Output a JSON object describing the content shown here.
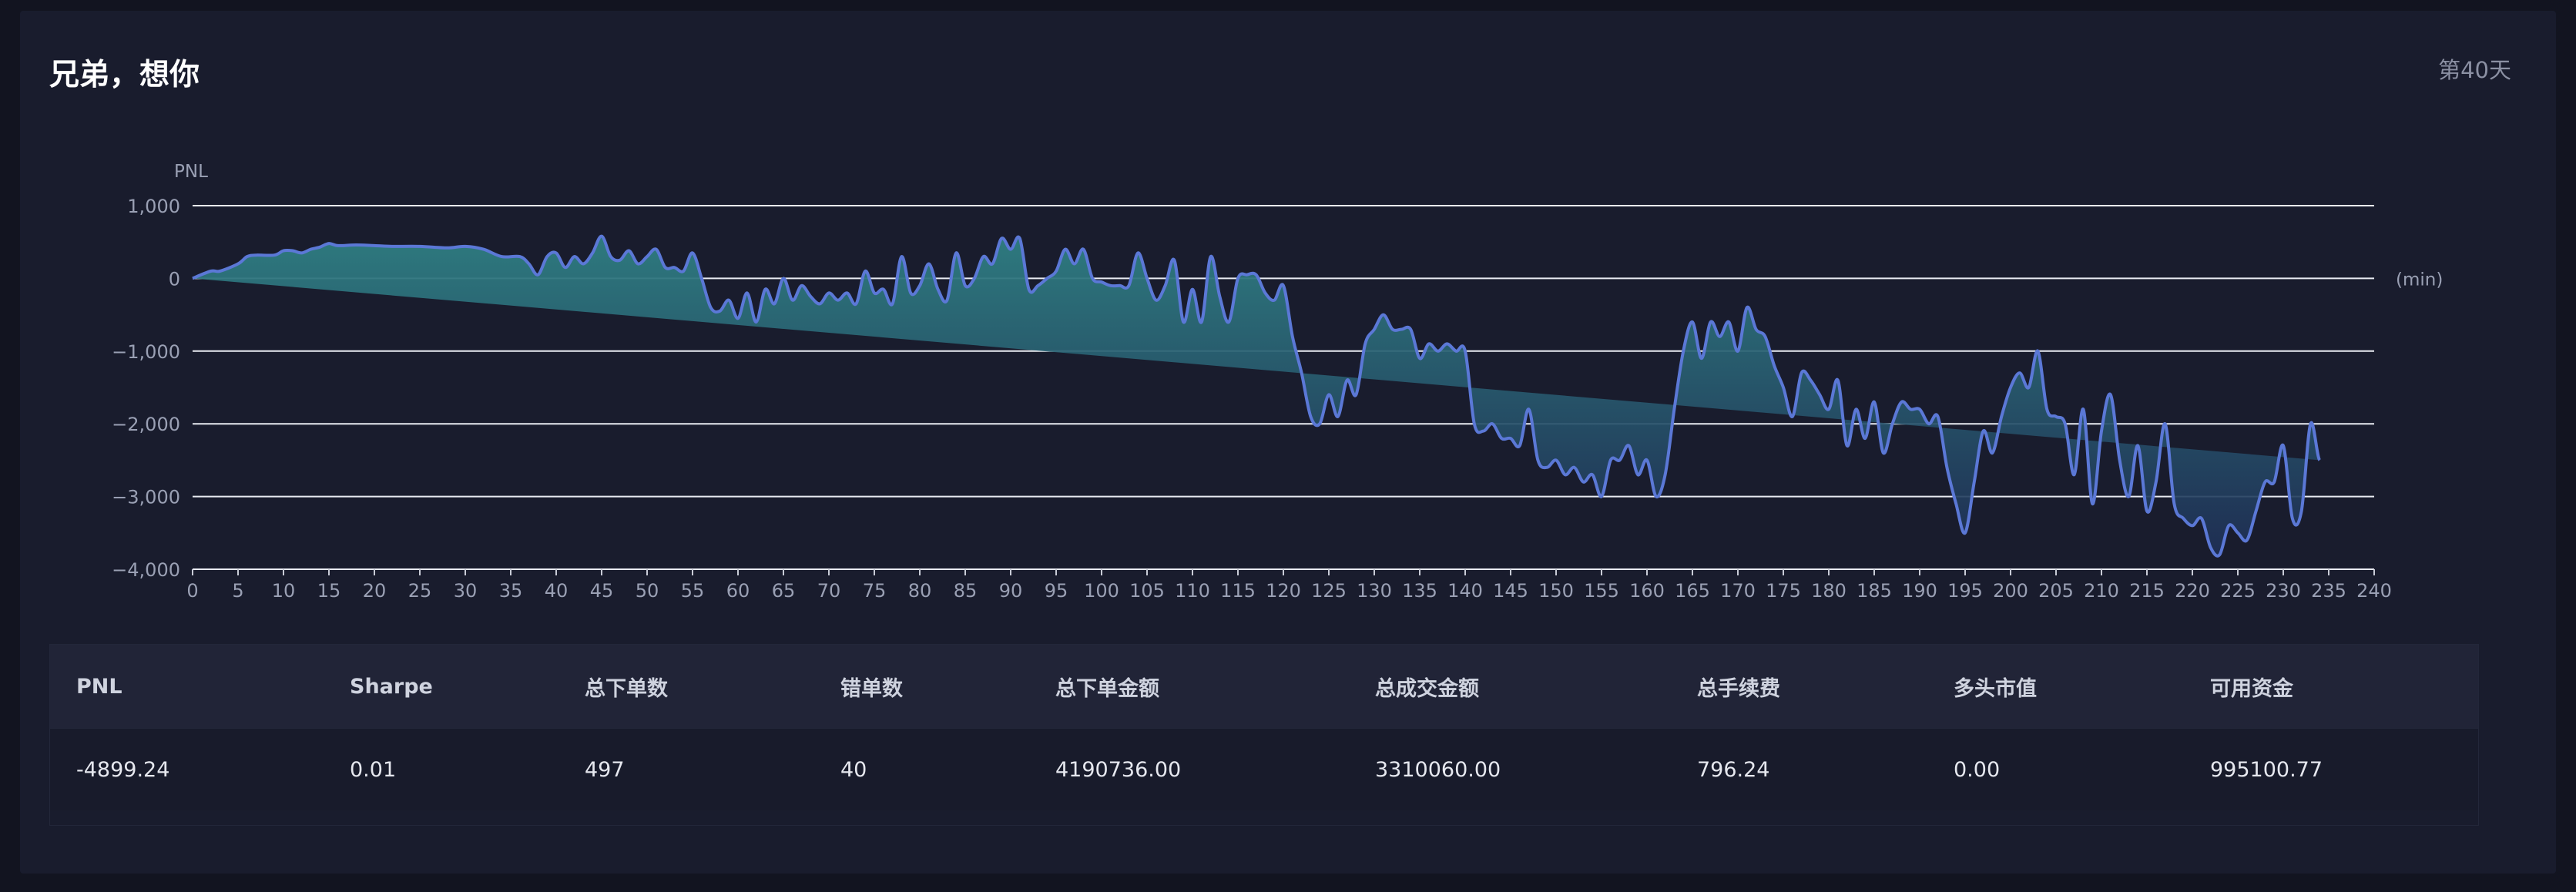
{
  "title": "兄弟，想你",
  "day_label": "第40天",
  "chart_data": {
    "type": "area",
    "ylabel": "PNL",
    "xlabel": "(min)",
    "ylim": [
      -4000,
      1000
    ],
    "yticks": [
      1000,
      0,
      -1000,
      -2000,
      -3000,
      -4000
    ],
    "ytick_labels": [
      "1,000",
      "0",
      "−1,000",
      "−2,000",
      "−3,000",
      "−4,000"
    ],
    "xlim": [
      0,
      240
    ],
    "xticks": [
      0,
      5,
      10,
      15,
      20,
      25,
      30,
      35,
      40,
      45,
      50,
      55,
      60,
      65,
      70,
      75,
      80,
      85,
      90,
      95,
      100,
      105,
      110,
      115,
      120,
      125,
      130,
      135,
      140,
      145,
      150,
      155,
      160,
      165,
      170,
      175,
      180,
      185,
      190,
      195,
      200,
      205,
      210,
      215,
      220,
      225,
      230,
      235,
      240
    ],
    "grid": true,
    "colors": {
      "line": "#5b78d6",
      "fill_top": "#2f7f83",
      "fill_bottom": "#1f2f56"
    },
    "x": [
      0,
      2,
      3,
      5,
      6,
      7,
      9,
      10,
      11,
      12,
      13,
      14,
      15,
      16,
      18,
      20,
      22,
      25,
      28,
      30,
      32,
      34,
      36,
      37,
      38,
      39,
      40,
      41,
      42,
      43,
      44,
      45,
      46,
      47,
      48,
      49,
      50,
      51,
      52,
      53,
      54,
      55,
      56,
      57,
      58,
      59,
      60,
      61,
      62,
      63,
      64,
      65,
      66,
      67,
      68,
      69,
      70,
      71,
      72,
      73,
      74,
      75,
      76,
      77,
      78,
      79,
      80,
      81,
      82,
      83,
      84,
      85,
      86,
      87,
      88,
      89,
      90,
      91,
      92,
      93,
      94,
      95,
      96,
      97,
      98,
      99,
      100,
      101,
      102,
      103,
      104,
      105,
      106,
      107,
      108,
      109,
      110,
      111,
      112,
      113,
      114,
      115,
      116,
      117,
      118,
      119,
      120,
      121,
      122,
      123,
      124,
      125,
      126,
      127,
      128,
      129,
      130,
      131,
      132,
      133,
      134,
      135,
      136,
      137,
      138,
      139,
      140,
      141,
      142,
      143,
      144,
      145,
      146,
      147,
      148,
      149,
      150,
      151,
      152,
      153,
      154,
      155,
      156,
      157,
      158,
      159,
      160,
      161,
      162,
      163,
      164,
      165,
      166,
      167,
      168,
      169,
      170,
      171,
      172,
      173,
      174,
      175,
      176,
      177,
      178,
      179,
      180,
      181,
      182,
      183,
      184,
      185,
      186,
      187,
      188,
      189,
      190,
      191,
      192,
      193,
      194,
      195,
      196,
      197,
      198,
      199,
      200,
      201,
      202,
      203,
      204,
      205,
      206,
      207,
      208,
      209,
      210,
      211,
      212,
      213,
      214,
      215,
      216,
      217,
      218,
      219,
      220,
      221,
      222,
      223,
      224,
      225,
      226,
      227,
      228,
      229,
      230,
      231,
      232,
      233,
      234,
      235,
      236,
      237,
      238,
      239,
      240
    ],
    "y": [
      0,
      100,
      100,
      200,
      300,
      320,
      320,
      380,
      380,
      350,
      400,
      430,
      480,
      450,
      460,
      450,
      440,
      440,
      420,
      440,
      400,
      300,
      300,
      200,
      50,
      300,
      350,
      150,
      300,
      200,
      350,
      580,
      300,
      250,
      380,
      200,
      300,
      400,
      150,
      150,
      100,
      350,
      0,
      -400,
      -450,
      -300,
      -550,
      -200,
      -600,
      -150,
      -350,
      0,
      -300,
      -100,
      -250,
      -350,
      -200,
      -300,
      -200,
      -350,
      100,
      -200,
      -150,
      -350,
      300,
      -200,
      -100,
      200,
      -150,
      -300,
      350,
      -100,
      0,
      300,
      200,
      550,
      400,
      550,
      -150,
      -100,
      0,
      100,
      400,
      200,
      400,
      0,
      -50,
      -100,
      -100,
      -100,
      350,
      0,
      -300,
      -100,
      250,
      -600,
      -150,
      -600,
      300,
      -250,
      -600,
      0,
      50,
      50,
      -200,
      -300,
      -100,
      -800,
      -1300,
      -1900,
      -2000,
      -1600,
      -1900,
      -1400,
      -1600,
      -900,
      -700,
      -500,
      -700,
      -700,
      -700,
      -1100,
      -900,
      -1000,
      -900,
      -1000,
      -1000,
      -2000,
      -2100,
      -2000,
      -2200,
      -2200,
      -2300,
      -1800,
      -2500,
      -2600,
      -2500,
      -2700,
      -2600,
      -2800,
      -2700,
      -3000,
      -2500,
      -2500,
      -2300,
      -2700,
      -2500,
      -3000,
      -2700,
      -1800,
      -1000,
      -600,
      -1100,
      -600,
      -800,
      -600,
      -1000,
      -400,
      -700,
      -800,
      -1200,
      -1500,
      -1900,
      -1300,
      -1400,
      -1600,
      -1800,
      -1400,
      -2300,
      -1800,
      -2200,
      -1700,
      -2400,
      -2000,
      -1700,
      -1800,
      -1800,
      -2000,
      -1900,
      -2600,
      -3100,
      -3500,
      -2800,
      -2100,
      -2400,
      -1900,
      -1500,
      -1300,
      -1500,
      -1000,
      -1800,
      -1900,
      -2000,
      -2700,
      -1800,
      -3100,
      -2100,
      -1600,
      -2500,
      -3000,
      -2300,
      -3200,
      -2800,
      -2000,
      -3100,
      -3300,
      -3400,
      -3300,
      -3700,
      -3800,
      -3400,
      -3500,
      -3600,
      -3200,
      -2800,
      -2800,
      -2300,
      -3300,
      -3200,
      -2000,
      -2500,
      -2300
    ]
  },
  "stats": {
    "headers": [
      "PNL",
      "Sharpe",
      "总下单数",
      "错单数",
      "总下单金额",
      "总成交金额",
      "总手续费",
      "多头市值",
      "可用资金"
    ],
    "values": [
      "-4899.24",
      "0.01",
      "497",
      "40",
      "4190736.00",
      "3310060.00",
      "796.24",
      "0.00",
      "995100.77"
    ]
  }
}
